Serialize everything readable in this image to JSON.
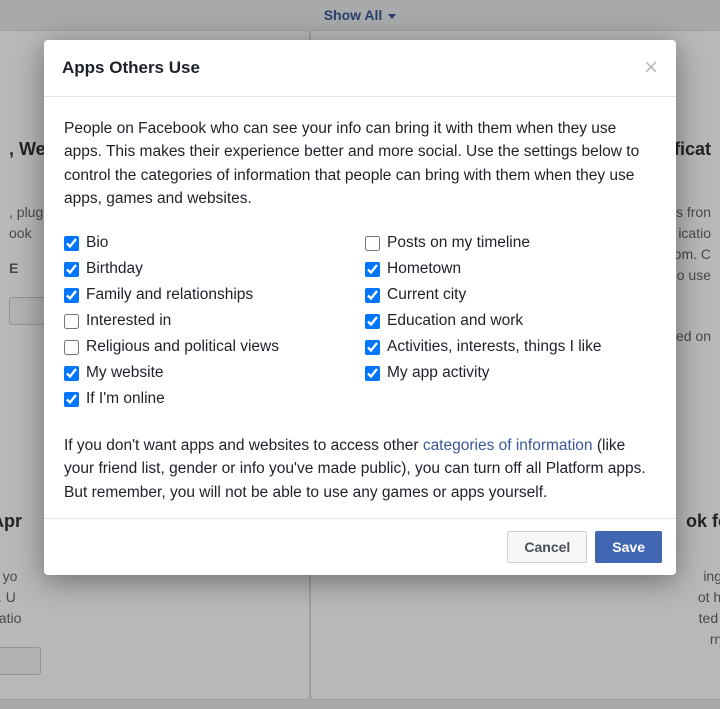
{
  "header": {
    "show_all_label": "Show All"
  },
  "background": {
    "left_upper_title": ", We",
    "left_upper_text1": ", plug",
    "left_upper_text2": "ook",
    "left_upper_text3": "E",
    "left_lower_title": "Apr",
    "left_lower_text1": "e yo",
    "left_lower_text2": "s. U",
    "left_lower_text3": "natio",
    "right_upper_title": "ficat",
    "right_upper_text1": "s fron",
    "right_upper_text2": "icatio",
    "right_upper_text3": "om. C",
    "right_upper_text4": "o use",
    "right_upper_text5": "ed on",
    "right_lower_title": "ok fo",
    "right_lower_text1": "ings",
    "right_lower_text2": "ot ha",
    "right_lower_text3": "ted v",
    "right_lower_text4": "rry."
  },
  "dialog": {
    "title": "Apps Others Use",
    "intro": "People on Facebook who can see your info can bring it with them when they use apps. This makes their experience better and more social. Use the settings below to control the categories of information that people can bring with them when they use apps, games and websites.",
    "footer_pre": "If you don't want apps and websites to access other ",
    "footer_link": "categories of information",
    "footer_post": " (like your friend list, gender or info you've made public), you can turn off all Platform apps. But remember, you will not be able to use any games or apps yourself.",
    "cancel_label": "Cancel",
    "save_label": "Save"
  },
  "checkboxes": {
    "left": [
      {
        "label": "Bio",
        "checked": true
      },
      {
        "label": "Birthday",
        "checked": true
      },
      {
        "label": "Family and relationships",
        "checked": true
      },
      {
        "label": "Interested in",
        "checked": false
      },
      {
        "label": "Religious and political views",
        "checked": false
      },
      {
        "label": "My website",
        "checked": true
      },
      {
        "label": "If I'm online",
        "checked": true
      }
    ],
    "right": [
      {
        "label": "Posts on my timeline",
        "checked": false
      },
      {
        "label": "Hometown",
        "checked": true
      },
      {
        "label": "Current city",
        "checked": true
      },
      {
        "label": "Education and work",
        "checked": true
      },
      {
        "label": "Activities, interests, things I like",
        "checked": true
      },
      {
        "label": "My app activity",
        "checked": true
      }
    ]
  }
}
